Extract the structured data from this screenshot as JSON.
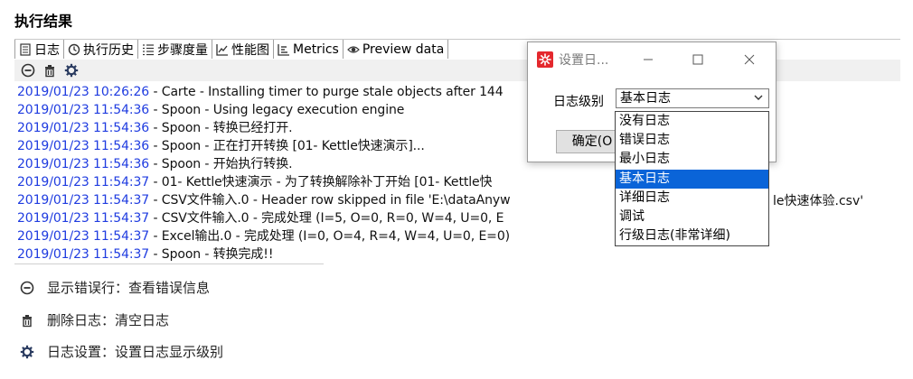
{
  "panel": {
    "title": "执行结果"
  },
  "tabs": [
    {
      "label": "日志",
      "icon": "document-icon"
    },
    {
      "label": "执行历史",
      "icon": "history-icon"
    },
    {
      "label": "步骤度量",
      "icon": "list-icon"
    },
    {
      "label": "性能图",
      "icon": "chart-icon"
    },
    {
      "label": "Metrics",
      "icon": "metrics-icon"
    },
    {
      "label": "Preview data",
      "icon": "eye-icon"
    }
  ],
  "toolbar": {
    "show_errors_icon": "minus-circle-icon",
    "delete_icon": "trash-icon",
    "settings_icon": "gear-icon"
  },
  "log_lines": [
    {
      "ts": "2019/01/23 10:26:26",
      "msg": " - Carte - Installing timer to purge stale objects after 144"
    },
    {
      "ts": "2019/01/23 11:54:36",
      "msg": " - Spoon - Using legacy execution engine"
    },
    {
      "ts": "2019/01/23 11:54:36",
      "msg": " - Spoon - 转换已经打开."
    },
    {
      "ts": "2019/01/23 11:54:36",
      "msg": " - Spoon - 正在打开转换 [01- Kettle快速演示]..."
    },
    {
      "ts": "2019/01/23 11:54:36",
      "msg": " - Spoon - 开始执行转换."
    },
    {
      "ts": "2019/01/23 11:54:37",
      "msg": " - 01- Kettle快速演示 - 为了转换解除补丁开始  [01- Kettle快"
    },
    {
      "ts": "2019/01/23 11:54:37",
      "msg": " - CSV文件输入.0 - Header row skipped in file 'E:\\dataAnyw"
    },
    {
      "ts": "2019/01/23 11:54:37",
      "msg": " - CSV文件输入.0 - 完成处理 (I=5, O=0, R=0, W=4, U=0, E"
    },
    {
      "ts": "2019/01/23 11:54:37",
      "msg": " - Excel输出.0 - 完成处理 (I=0, O=4, R=4, W=4, U=0, E=0)"
    },
    {
      "ts": "2019/01/23 11:54:37",
      "msg": " - Spoon - 转换完成!!"
    }
  ],
  "log_trailing_text": "le快速体验.csv'",
  "legend": [
    {
      "icon": "minus-circle-icon",
      "text": "显示错误行：查看错误信息"
    },
    {
      "icon": "trash-icon",
      "text": "删除日志：清空日志"
    },
    {
      "icon": "gear-icon",
      "text": "日志设置：设置日志显示级别"
    }
  ],
  "dialog": {
    "title": "设置日...",
    "label": "日志级别",
    "selected": "基本日志",
    "ok_label": "确定(O",
    "options": [
      "没有日志",
      "错误日志",
      "最小日志",
      "基本日志",
      "详细日志",
      "调试",
      "行级日志(非常详细)"
    ],
    "selected_index": 3
  },
  "colors": {
    "timestamp": "#1f3ce0",
    "selection": "#0a64d8",
    "app_icon": "#e4282d"
  }
}
